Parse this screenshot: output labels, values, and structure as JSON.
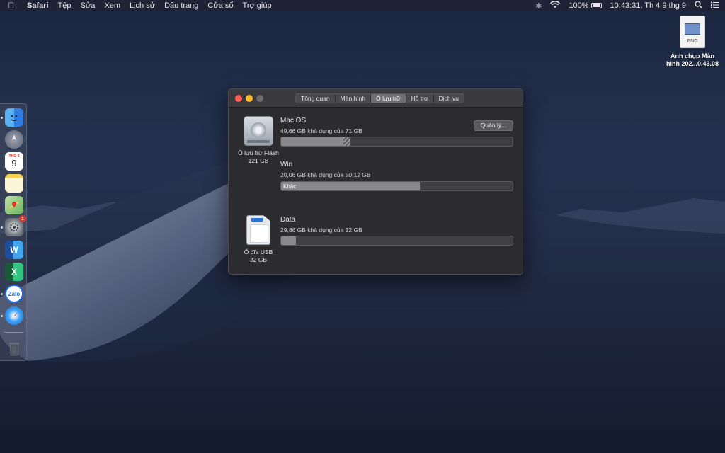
{
  "menubar": {
    "apple_icon": "apple-icon",
    "app_name": "Safari",
    "menus": [
      "Tệp",
      "Sửa",
      "Xem",
      "Lịch sử",
      "Dấu trang",
      "Cửa sổ",
      "Trợ giúp"
    ],
    "battery_percent": "100%",
    "datetime": "10:43:31, Th 4 9 thg 9"
  },
  "desktop_file": {
    "extension": "PNG",
    "label_line1": "Ảnh chụp Màn",
    "label_line2": "hình 202...0.43.08"
  },
  "dock": {
    "items": [
      {
        "name": "finder-icon",
        "color": "#2f7de1",
        "running": true
      },
      {
        "name": "launchpad-icon",
        "color": "#6b7384",
        "running": false
      },
      {
        "name": "calendar-icon",
        "color": "#ffffff",
        "running": false,
        "text": "9",
        "header": "THG 9"
      },
      {
        "name": "notes-icon",
        "color": "#f7e38a",
        "running": false
      },
      {
        "name": "maps-icon",
        "color": "#7fc36b",
        "running": false
      },
      {
        "name": "system-preferences-icon",
        "color": "#7a7e86",
        "running": true,
        "badge": "1"
      },
      {
        "name": "word-icon",
        "color": "#2b5bb8",
        "running": false,
        "text": "W"
      },
      {
        "name": "excel-icon",
        "color": "#1f7a45",
        "running": false,
        "text": "X"
      },
      {
        "name": "zalo-icon",
        "color": "#1f6fe5",
        "running": true,
        "text": "Zalo"
      },
      {
        "name": "safari-icon",
        "color": "#2a8ef0",
        "running": true
      },
      {
        "name": "trash-icon",
        "color": "#4a4e58",
        "running": false
      }
    ]
  },
  "window": {
    "tabs": [
      {
        "label": "Tổng quan",
        "active": false
      },
      {
        "label": "Màn hình",
        "active": false
      },
      {
        "label": "Ổ lưu trữ",
        "active": true
      },
      {
        "label": "Hỗ trợ",
        "active": false
      },
      {
        "label": "Dịch vụ",
        "active": false
      }
    ],
    "flash_disk": {
      "label": "Ổ lưu trữ Flash",
      "size": "121 GB",
      "manage_label": "Quản lý...",
      "volumes": [
        {
          "name": "Mac OS",
          "available": "49,66 GB khả dụng của 71 GB",
          "used_fraction": 0.27,
          "purgeable_fraction": 0.03,
          "bar_label": ""
        },
        {
          "name": "Win",
          "available": "20,06 GB khả dụng của 50,12 GB",
          "used_fraction": 0.6,
          "purgeable_fraction": 0,
          "bar_label": "Khác"
        }
      ]
    },
    "usb_disk": {
      "label": "Ổ đĩa USB",
      "size": "32 GB",
      "volumes": [
        {
          "name": "Data",
          "available": "29,86 GB khả dụng của 32 GB",
          "used_fraction": 0.065,
          "purgeable_fraction": 0,
          "bar_label": ""
        }
      ]
    }
  }
}
